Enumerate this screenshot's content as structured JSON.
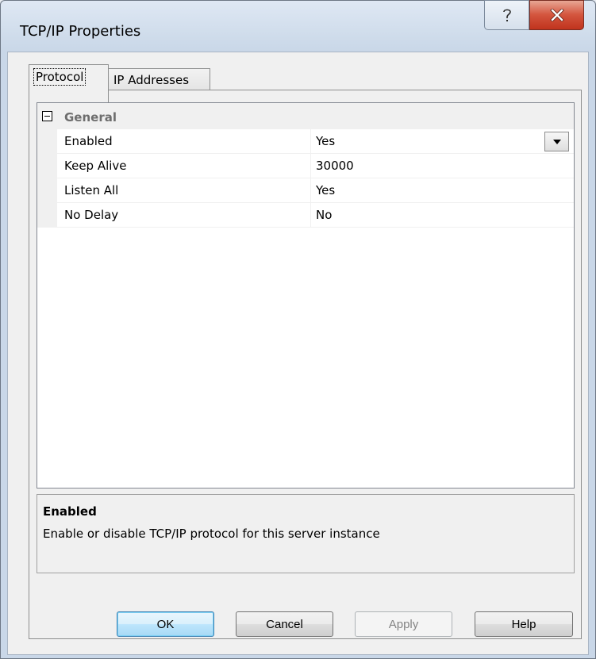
{
  "window": {
    "title": "TCP/IP Properties",
    "help_icon": "question-mark-icon",
    "close_icon": "close-x-icon"
  },
  "tabs": [
    {
      "label": "Protocol",
      "selected": true
    },
    {
      "label": "IP Addresses",
      "selected": false
    }
  ],
  "property_grid": {
    "category": {
      "label": "General",
      "expander_icon": "collapse-minus-icon"
    },
    "rows": [
      {
        "name": "Enabled",
        "value": "Yes",
        "has_dropdown": true
      },
      {
        "name": "Keep Alive",
        "value": "30000"
      },
      {
        "name": "Listen All",
        "value": "Yes"
      },
      {
        "name": "No Delay",
        "value": "No"
      }
    ]
  },
  "description": {
    "title": "Enabled",
    "text": "Enable or disable TCP/IP protocol for this server instance"
  },
  "buttons": {
    "ok": "OK",
    "cancel": "Cancel",
    "apply": "Apply",
    "help": "Help"
  },
  "colors": {
    "close_button": "#c0331d",
    "default_button_border": "#3c7fb1",
    "category_text": "#6d6d6d"
  }
}
